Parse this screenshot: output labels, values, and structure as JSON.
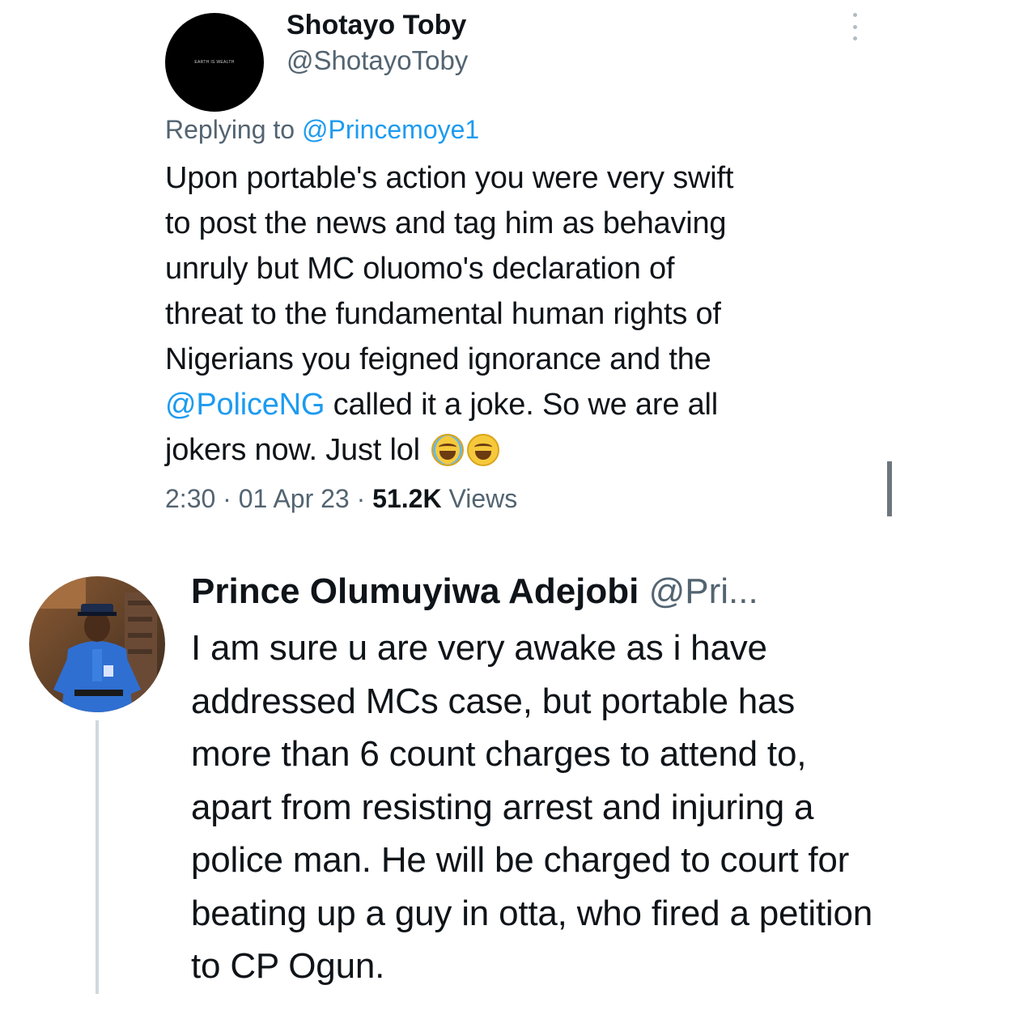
{
  "tweet1": {
    "avatar_text": "EARTH IS WEALTH",
    "name": "Shotayo Toby",
    "handle": "@ShotayoToby",
    "reply_prefix": "Replying to",
    "reply_handle": "@Princemoye1",
    "body_lines": [
      "Upon portable's action you were very swift",
      "to post the news and tag him as behaving",
      "unruly but MC oluomo's declaration of",
      "threat to the fundamental human rights of",
      "Nigerians you feigned ignorance and the"
    ],
    "mention": "@PoliceNG",
    "line6_rest": " called it a joke. So we are all",
    "line7": "jokers now. Just lol",
    "emojis": [
      "face-with-tears-of-joy",
      "grinning-squinting-face"
    ],
    "time": "2:30",
    "date": "01 Apr 23",
    "sep": "·",
    "views_count": "51.2K",
    "views_label": "Views"
  },
  "tweet2": {
    "name": "Prince Olumuyiwa Adejobi",
    "handle": "@Pri...",
    "body_lines": [
      "I am sure u are very awake as i have",
      "addressed MCs  case, but portable has",
      "more than 6 count charges to attend to,",
      "apart from resisting arrest and injuring a",
      "police man. He will be charged to court for",
      "beating up a guy in otta, who fired a petition",
      "to CP Ogun."
    ]
  },
  "colors": {
    "text": "#0f1419",
    "secondary": "#536471",
    "link": "#1d9bf0",
    "thread_line": "#cfd9de"
  }
}
